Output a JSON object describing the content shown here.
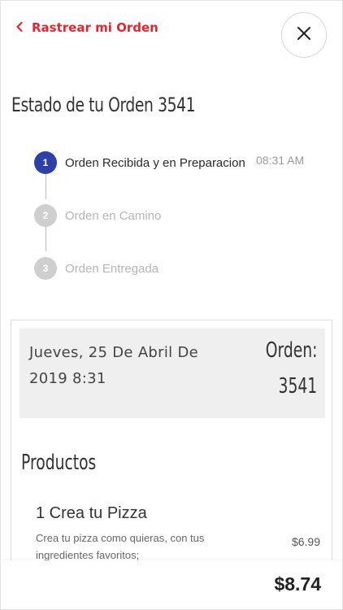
{
  "header": {
    "back_label": "Rastrear mi Orden",
    "back_icon": "chevron-left-icon",
    "close_icon": "close-icon",
    "accent_color": "#e3262f"
  },
  "status": {
    "title": "Estado de tu Orden 3541",
    "steps": [
      {
        "number": "1",
        "label": "Orden Recibida y en Preparacion",
        "time": "08:31 AM",
        "active": true
      },
      {
        "number": "2",
        "label": "Orden en Camino",
        "active": false
      },
      {
        "number": "3",
        "label": "Orden Entregada",
        "active": false
      }
    ],
    "active_color": "#2e3fa8"
  },
  "order": {
    "date": "Jueves, 25 De Abril De 2019 8:31",
    "label": "Orden:",
    "number": "3541",
    "products_heading": "Productos",
    "items": [
      {
        "name": "1 Crea tu Pizza",
        "description": "Crea tu pizza como quieras, con tus ingredientes favoritos;",
        "price": "$6.99"
      }
    ]
  },
  "footer": {
    "total": "$8.74"
  }
}
